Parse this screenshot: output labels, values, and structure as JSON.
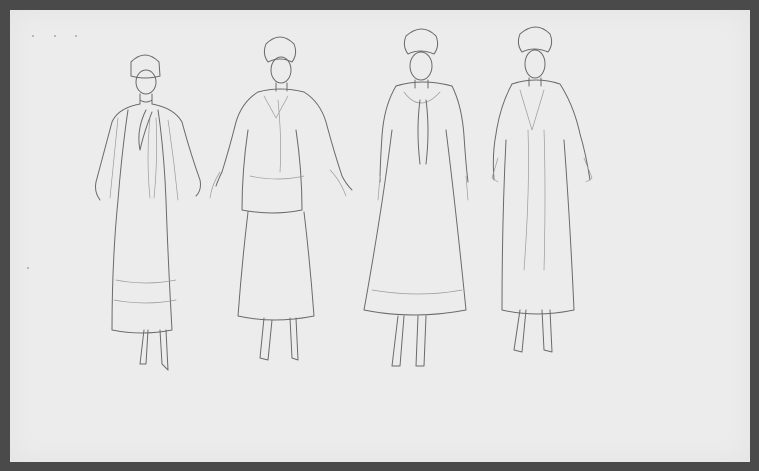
{
  "sheet": {
    "paper_color": "#ececec",
    "background_color": "#4a4a4a",
    "pencil_color": "#6a6a6a"
  },
  "figures": [
    {
      "name": "costume-sketch-1",
      "description_icon": "figure-with-hat-and-long-dress"
    },
    {
      "name": "costume-sketch-2",
      "description_icon": "figure-with-jacket-and-skirt"
    },
    {
      "name": "costume-sketch-3",
      "description_icon": "figure-with-long-coat-dress"
    },
    {
      "name": "costume-sketch-4",
      "description_icon": "figure-with-long-coat"
    }
  ]
}
